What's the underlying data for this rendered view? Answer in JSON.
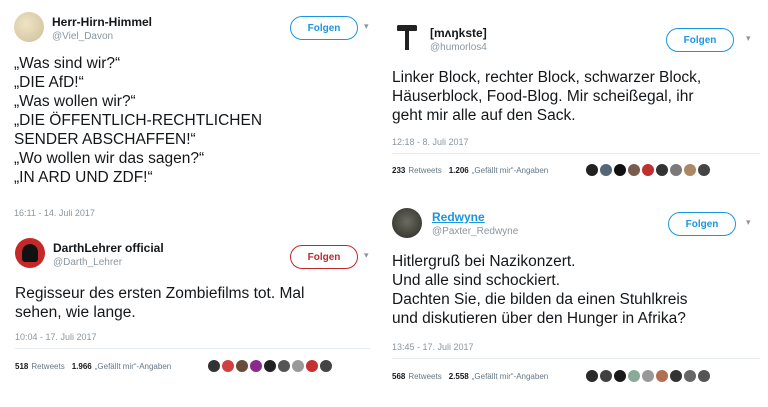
{
  "tweets": [
    {
      "name": "Herr-Hirn-Himmel",
      "handle": "@Viel_Davon",
      "follow": "Folgen",
      "text": "„Was sind wir?“\n„DIE AfD!“\n„Was wollen wir?“\n„DIE ÖFFENTLICH-RECHTLICHEN\nSENDER ABSCHAFFEN!“\n„Wo wollen wir das sagen?“\n„IN ARD UND ZDF!“",
      "time": "16:11 - 14. Juli 2017",
      "avatar_icon": "beige-avatar-icon"
    },
    {
      "name": "DarthLehrer official",
      "handle": "@Darth_Lehrer",
      "follow": "Folgen",
      "text": "Regisseur des ersten Zombiefilms tot. Mal\nsehen, wie lange.",
      "time": "10:04 - 17. Juli 2017",
      "retweets": "518",
      "retweets_label": "Retweets",
      "likes": "1.966",
      "likes_label": "„Gefällt mir“-Angaben",
      "avatar_icon": "darth-vader-avatar-icon"
    },
    {
      "name": "[mʌŋkste]",
      "handle": "@humorlos4",
      "follow": "Folgen",
      "text": "Linker Block, rechter Block, schwarzer Block,\nHäuserblock, Food-Blog. Mir scheißegal, ihr\ngeht mir alle auf den Sack.",
      "time": "12:18 - 8. Juli 2017",
      "retweets": "233",
      "retweets_label": "Retweets",
      "likes": "1.206",
      "likes_label": "„Gefällt mir“-Angaben",
      "avatar_icon": "hammer-avatar-icon"
    },
    {
      "name": "Redwyne",
      "handle": "@Paxter_Redwyne",
      "follow": "Folgen",
      "text": "Hitlergruß bei Nazikonzert.\nUnd alle sind schockiert.\nDachten Sie, die bilden da einen Stuhlkreis\nund diskutieren über den Hunger in Afrika?",
      "time": "13:45 - 17. Juli 2017",
      "retweets": "568",
      "retweets_label": "Retweets",
      "likes": "2.558",
      "likes_label": "„Gefällt mir“-Angaben",
      "avatar_icon": "dark-photo-avatar-icon"
    }
  ],
  "colors": {
    "follow_blue": "#1b95e0",
    "follow_red": "#c0282d",
    "face_colors_a": [
      "#333333",
      "#d04040",
      "#6a4a3a",
      "#8a2a8a",
      "#222222",
      "#555555",
      "#999999",
      "#c63030",
      "#444444"
    ],
    "face_colors_b": [
      "#222222",
      "#556677",
      "#111111",
      "#7a5a4a",
      "#c03030",
      "#333333",
      "#7a7a7a",
      "#aa8866",
      "#444444"
    ],
    "face_colors_c": [
      "#2a2a2a",
      "#404040",
      "#1a1a1a",
      "#88aa99",
      "#999999",
      "#b07050",
      "#333333",
      "#666666",
      "#555555"
    ]
  }
}
